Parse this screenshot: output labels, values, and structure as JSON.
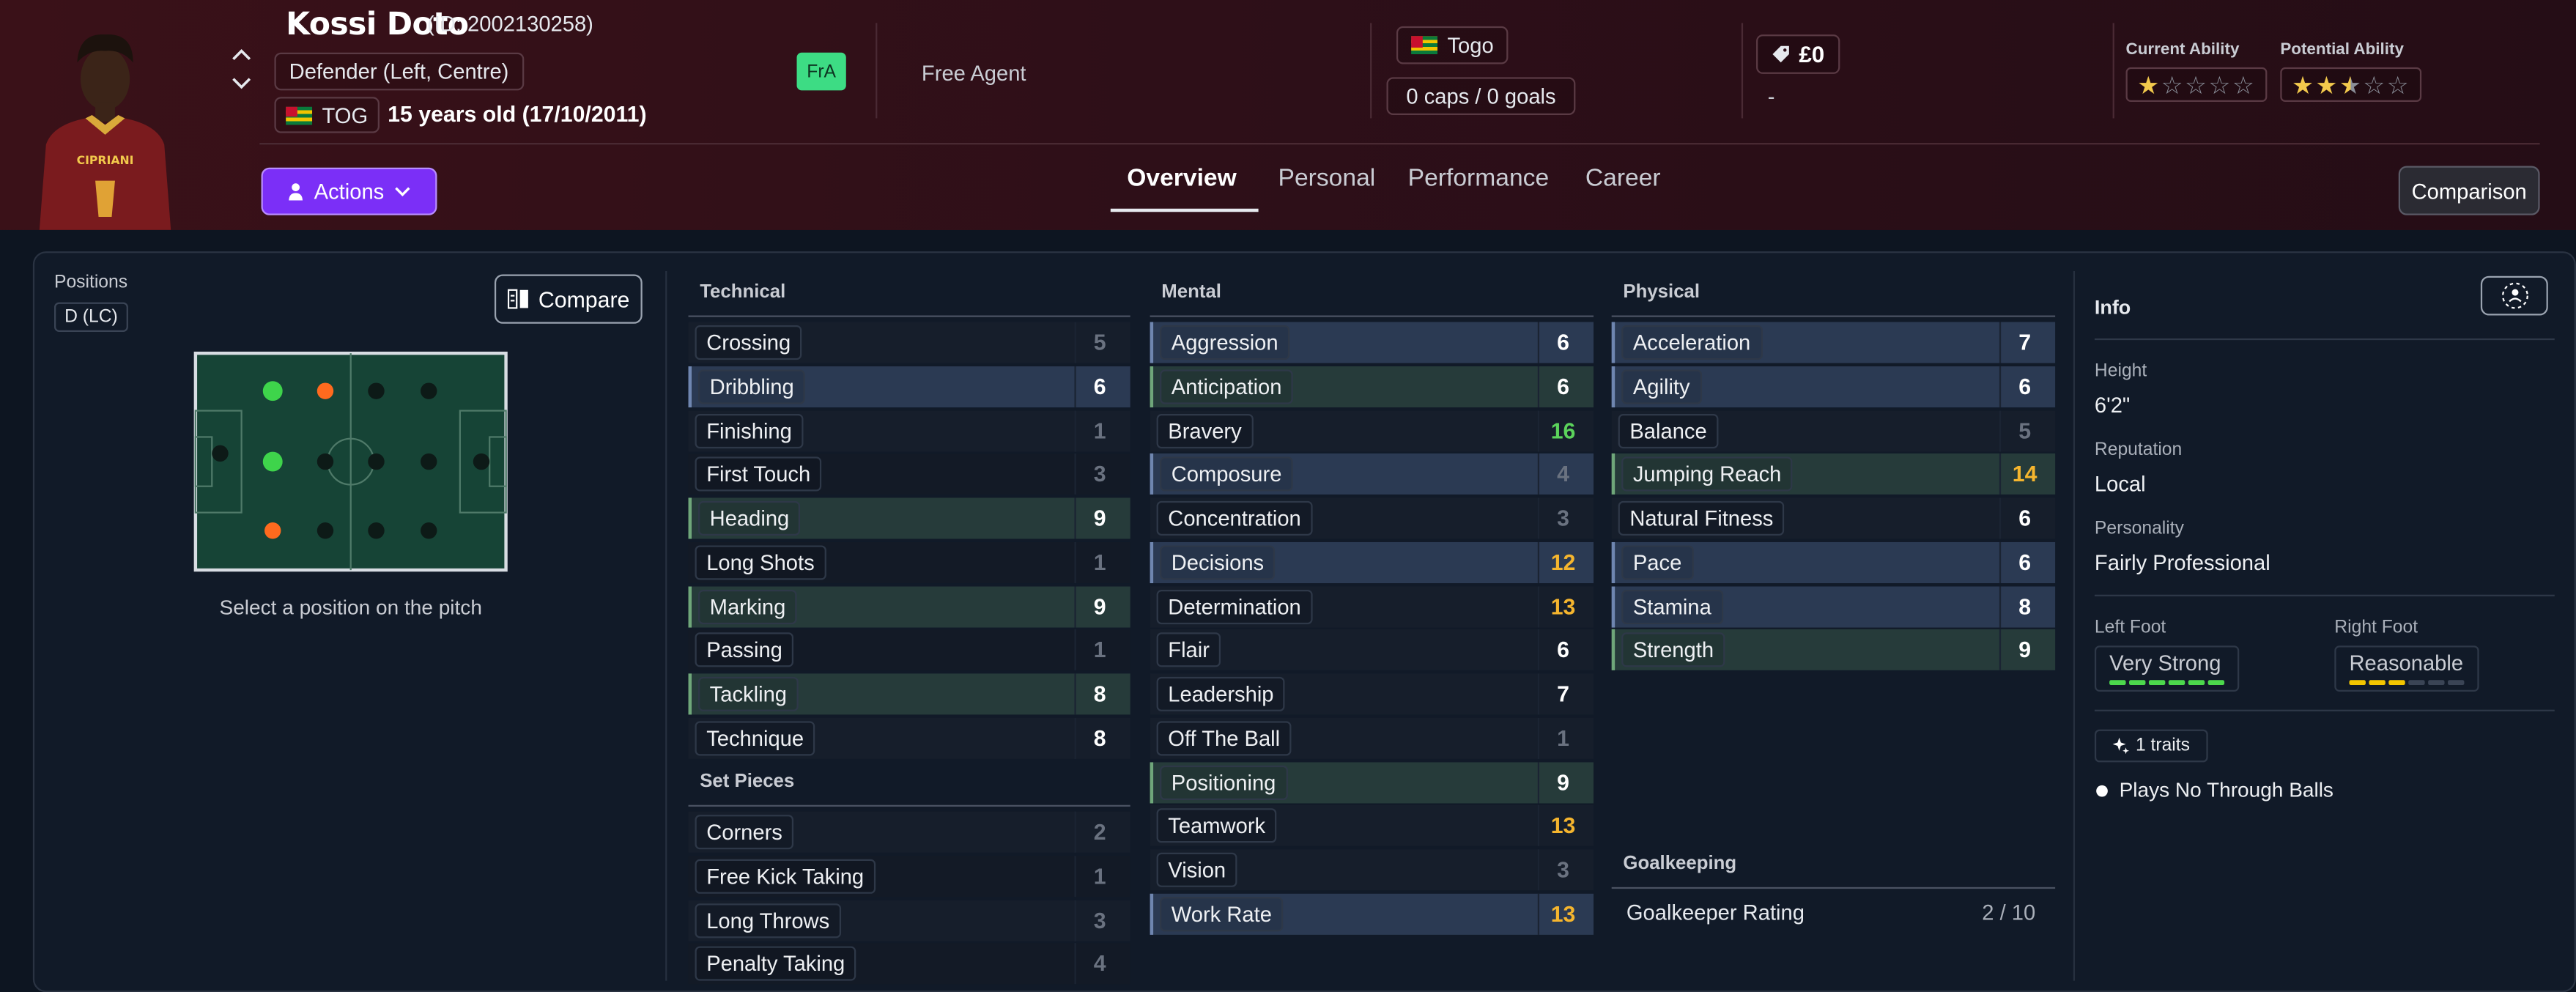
{
  "player": {
    "name": "Kossi Doto",
    "id_text": "(ID: 2002130258)",
    "position": "Defender (Left, Centre)",
    "nation_code": "TOG",
    "age_text": "15 years old (17/10/2011)",
    "club_badge": "FrA",
    "club_status": "Free Agent",
    "nation": "Togo",
    "caps_goals": "0 caps / 0 goals",
    "value": "£0",
    "value_sub": "-",
    "current_ability_label": "Current Ability",
    "potential_ability_label": "Potential Ability",
    "current_ability_stars": 1,
    "potential_ability_stars": 2.5,
    "max_stars": 5
  },
  "toolbar": {
    "actions_label": "Actions",
    "comparison_label": "Comparison"
  },
  "tabs": [
    "Overview",
    "Personal",
    "Performance",
    "Career"
  ],
  "positions": {
    "label": "Positions",
    "badge": "D (LC)",
    "compare_label": "Compare",
    "hint": "Select a position on the pitch"
  },
  "technical": {
    "title": "Technical",
    "attrs": [
      {
        "name": "Crossing",
        "value": "5"
      },
      {
        "name": "Dribbling",
        "value": "6"
      },
      {
        "name": "Finishing",
        "value": "1"
      },
      {
        "name": "First Touch",
        "value": "3"
      },
      {
        "name": "Heading",
        "value": "9"
      },
      {
        "name": "Long Shots",
        "value": "1"
      },
      {
        "name": "Marking",
        "value": "9"
      },
      {
        "name": "Passing",
        "value": "1"
      },
      {
        "name": "Tackling",
        "value": "8"
      },
      {
        "name": "Technique",
        "value": "8"
      }
    ]
  },
  "set_pieces": {
    "title": "Set Pieces",
    "attrs": [
      {
        "name": "Corners",
        "value": "2"
      },
      {
        "name": "Free Kick Taking",
        "value": "1"
      },
      {
        "name": "Long Throws",
        "value": "3"
      },
      {
        "name": "Penalty Taking",
        "value": "4"
      }
    ]
  },
  "mental": {
    "title": "Mental",
    "attrs": [
      {
        "name": "Aggression",
        "value": "6"
      },
      {
        "name": "Anticipation",
        "value": "6"
      },
      {
        "name": "Bravery",
        "value": "16"
      },
      {
        "name": "Composure",
        "value": "4"
      },
      {
        "name": "Concentration",
        "value": "3"
      },
      {
        "name": "Decisions",
        "value": "12"
      },
      {
        "name": "Determination",
        "value": "13"
      },
      {
        "name": "Flair",
        "value": "6"
      },
      {
        "name": "Leadership",
        "value": "7"
      },
      {
        "name": "Off The Ball",
        "value": "1"
      },
      {
        "name": "Positioning",
        "value": "9"
      },
      {
        "name": "Teamwork",
        "value": "13"
      },
      {
        "name": "Vision",
        "value": "3"
      },
      {
        "name": "Work Rate",
        "value": "13"
      }
    ]
  },
  "physical": {
    "title": "Physical",
    "attrs": [
      {
        "name": "Acceleration",
        "value": "7"
      },
      {
        "name": "Agility",
        "value": "6"
      },
      {
        "name": "Balance",
        "value": "5"
      },
      {
        "name": "Jumping Reach",
        "value": "14"
      },
      {
        "name": "Natural Fitness",
        "value": "6"
      },
      {
        "name": "Pace",
        "value": "6"
      },
      {
        "name": "Stamina",
        "value": "8"
      },
      {
        "name": "Strength",
        "value": "9"
      }
    ]
  },
  "goalkeeping": {
    "title": "Goalkeeping",
    "rating_label": "Goalkeeper Rating",
    "rating_value": "2 / 10"
  },
  "info": {
    "title": "Info",
    "height_label": "Height",
    "height": "6'2\"",
    "reputation_label": "Reputation",
    "reputation": "Local",
    "personality_label": "Personality",
    "personality": "Fairly Professional",
    "left_foot_label": "Left Foot",
    "left_foot": "Very Strong",
    "left_foot_level": 6,
    "right_foot_label": "Right Foot",
    "right_foot": "Reasonable",
    "right_foot_level": 3,
    "traits_label": "1 traits",
    "trait_1": "Plays No Through Balls"
  },
  "colors": {
    "accent": "#7b2ff7",
    "good": "#5bd35b",
    "warn": "#f5b52e",
    "fra_badge": "#3ddc84"
  }
}
